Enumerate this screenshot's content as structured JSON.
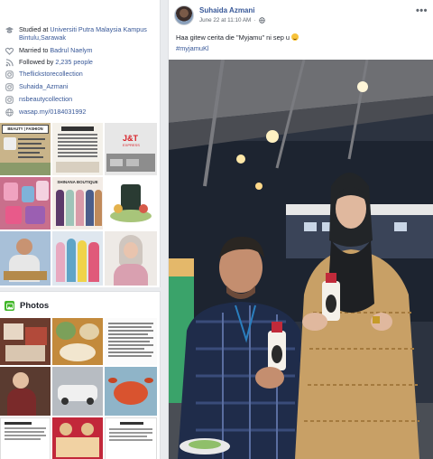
{
  "intro": {
    "items": [
      {
        "icon": "graduation-cap-icon",
        "prefix": "Studied at ",
        "link": "Universiti Putra Malaysia Kampus Bintulu,Sarawak"
      },
      {
        "icon": "heart-icon",
        "prefix": "Married to ",
        "link": "Badrul Naelym"
      },
      {
        "icon": "rss-icon",
        "prefix": "Followed by ",
        "link": "2,235 people"
      },
      {
        "icon": "instagram-icon",
        "prefix": "",
        "link": "Theflickstorecollection"
      },
      {
        "icon": "instagram-icon",
        "prefix": "",
        "link": "Suhaida_Azmani"
      },
      {
        "icon": "instagram-icon",
        "prefix": "",
        "link": "nsbeautycollection"
      },
      {
        "icon": "globe-icon",
        "prefix": "",
        "link": "wasap.my/0184031992"
      }
    ]
  },
  "featured": {
    "beauty_title": "BEAUTY | FASHION",
    "jt_label": "J&T",
    "jt_sub": "EXPRESS",
    "boutique_label": "SHINANA BOUTIQUE"
  },
  "photos": {
    "title": "Photos"
  },
  "post": {
    "author": "Suhaida Azmani",
    "timestamp": "June 22 at 11:10 AM",
    "separator": "·",
    "text": "Haa gitew cerita die \"Myjamu\" ni sep u",
    "hashtag": "#myjamuKl"
  },
  "colors": {
    "link": "#385898",
    "page_bg": "#e9ebee",
    "photos_icon": "#42b72a"
  }
}
